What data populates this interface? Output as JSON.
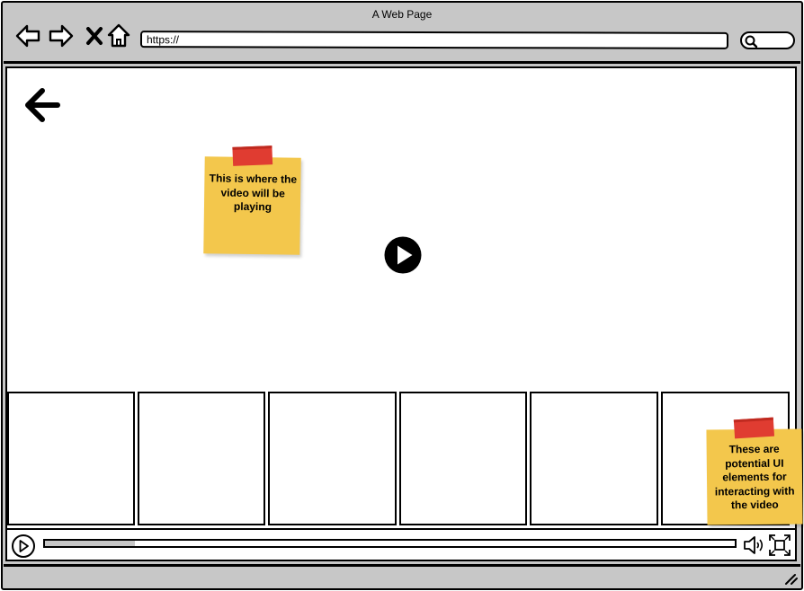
{
  "window": {
    "title": "A Web Page"
  },
  "toolbar": {
    "url": "https://",
    "icons": [
      "back-icon",
      "forward-icon",
      "close-icon",
      "home-icon",
      "search-icon"
    ]
  },
  "page": {
    "icons": [
      "back-arrow-icon",
      "play-icon"
    ],
    "thumbnail_count": 6
  },
  "player": {
    "progress": 0.13,
    "icons": [
      "play-icon",
      "volume-icon",
      "fullscreen-icon"
    ]
  },
  "notes": {
    "video": "This is where the video will be playing",
    "controls": "These are potential UI elements for interacting with the video"
  },
  "colors": {
    "chrome": "#c7c7c7",
    "sticky": "#f3c74c",
    "tape": "#e03c31"
  }
}
